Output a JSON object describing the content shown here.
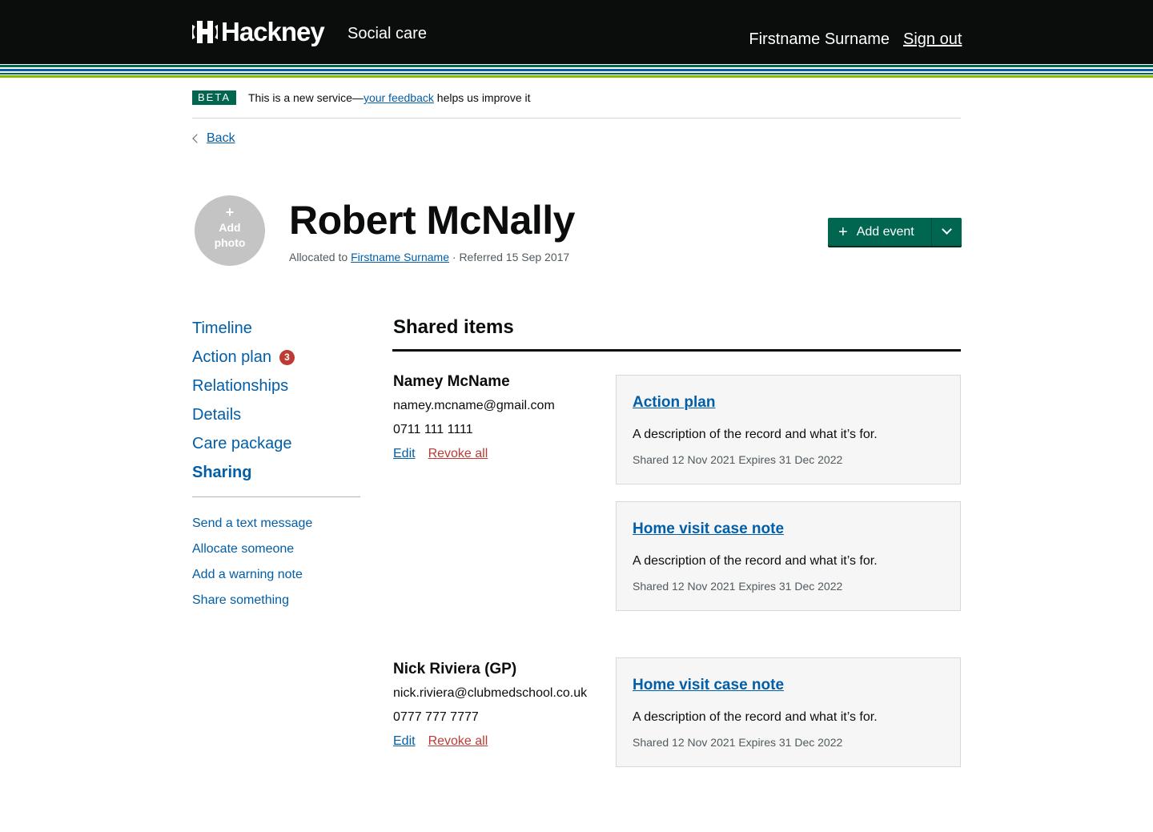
{
  "header": {
    "logo_text": "Hackney",
    "service_name": "Social care",
    "user_name": "Firstname Surname",
    "sign_out": "Sign out"
  },
  "phase_banner": {
    "tag": "BETA",
    "text_before": "This is a new service—",
    "link": "your feedback",
    "text_after": " helps us improve it"
  },
  "back_link": "Back",
  "person": {
    "avatar_plus": "+",
    "avatar_label": "Add photo",
    "name": "Robert McNally",
    "meta_prefix": "Allocated to ",
    "allocated_to": "Firstname Surname",
    "meta_suffix": " · Referred 15 Sep 2017"
  },
  "add_event": {
    "icon": "+",
    "label": "Add event"
  },
  "sidenav": {
    "items": [
      {
        "label": "Timeline"
      },
      {
        "label": "Action plan",
        "badge": "3"
      },
      {
        "label": "Relationships"
      },
      {
        "label": "Details"
      },
      {
        "label": "Care package"
      },
      {
        "label": "Sharing"
      }
    ],
    "actions": [
      "Send a text message",
      "Allocate someone",
      "Add a warning note",
      "Share something"
    ]
  },
  "main": {
    "title": "Shared items",
    "contacts": [
      {
        "name": "Namey McName",
        "email": "namey.mcname@gmail.com",
        "phone": "0711 111 1111",
        "edit": "Edit",
        "revoke": "Revoke all",
        "items": [
          {
            "title": "Action plan",
            "description": "A description of the record and what it’s for.",
            "meta": "Shared 12 Nov 2021 Expires 31 Dec 2022"
          },
          {
            "title": "Home visit case note",
            "description": "A description of the record and what it’s for.",
            "meta": "Shared 12 Nov 2021 Expires 31 Dec 2022"
          }
        ]
      },
      {
        "name": "Nick Riviera (GP)",
        "email": "nick.riviera@clubmedschool.co.uk",
        "phone": "0777 777 7777",
        "edit": "Edit",
        "revoke": "Revoke all",
        "items": [
          {
            "title": "Home visit case note",
            "description": "A description of the record and what it’s for.",
            "meta": "Shared 12 Nov 2021 Expires 31 Dec 2022"
          }
        ]
      }
    ]
  },
  "colors": {
    "header_bg": "#0b0c0c",
    "link": "#025ea6",
    "brand_green": "#00664f",
    "danger": "#be3a34",
    "stripe_1": "#00664f",
    "stripe_2": "#025ea6",
    "stripe_3": "#84bd00"
  }
}
